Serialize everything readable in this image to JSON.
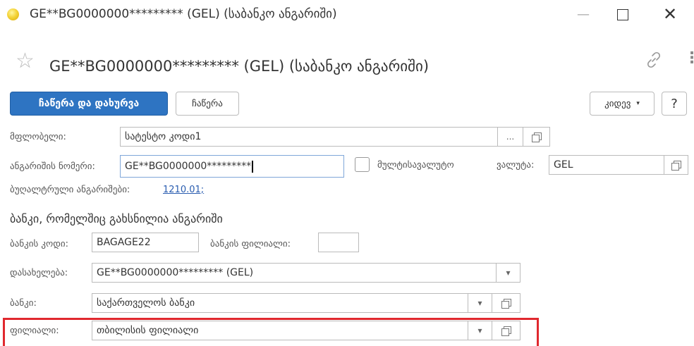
{
  "window": {
    "title": "GE**BG0000000********* (GEL) (საბანკო ანგარიში)",
    "minimize_glyph": "—",
    "close_glyph": "✕"
  },
  "form": {
    "title": "GE**BG0000000********* (GEL) (საბანკო ანგარიში)"
  },
  "toolbar": {
    "save_close_label": "ჩაწერა და დახურვა",
    "save_label": "ჩაწერა",
    "more_label": "კიდევ",
    "help_label": "?"
  },
  "fields": {
    "owner": {
      "label": "მფლობელი:",
      "value": "სატესტო კოდი1",
      "select_glyph": "..."
    },
    "account_number": {
      "label": "ანგარიშის ნომერი:",
      "value": "GE**BG0000000*********"
    },
    "multicurrency": {
      "label": "მულტისავალუტო",
      "checked": false
    },
    "currency": {
      "label": "ვალუტა:",
      "value": "GEL"
    },
    "accounting": {
      "label": "ბუღალტრული ანგარიშები:",
      "value": "1210.01;"
    },
    "bank_section_title": "ბანკი, რომელშიც გახსნილია ანგარიში",
    "bank_code": {
      "label": "ბანკის კოდი:",
      "value": "BAGAGE22"
    },
    "bank_branch_code": {
      "label": "ბანკის ფილიალი:",
      "value": ""
    },
    "name": {
      "label": "დასახელება:",
      "value": "GE**BG0000000********* (GEL)"
    },
    "bank": {
      "label": "ბანკი:",
      "value": "საქართველოს ბანკი"
    },
    "branch": {
      "label": "ფილიალი:",
      "value": "თბილისის ფილიალი"
    }
  },
  "icons": {
    "app": "yellow-circle-icon",
    "star": "☆",
    "link": "link-icon",
    "more": "⋮",
    "dropdown": "▾"
  },
  "colors": {
    "primary_button": "#2e74c2",
    "link": "#2a5db0",
    "highlight": "#e0282e",
    "active_border": "#7fa7d9"
  }
}
